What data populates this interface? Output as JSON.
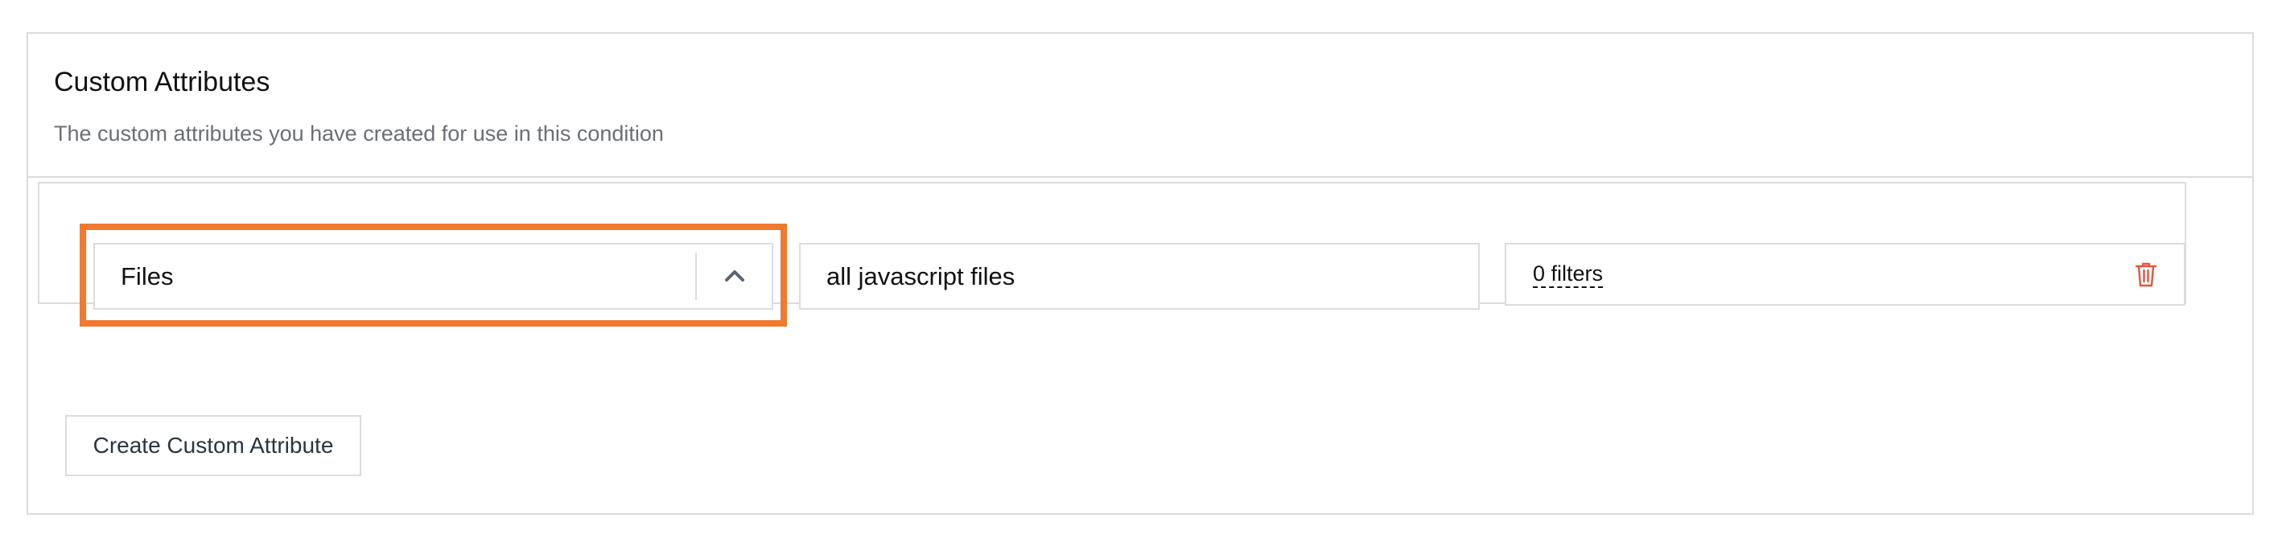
{
  "section": {
    "title": "Custom Attributes",
    "subtitle": "The custom attributes you have created for use in this condition"
  },
  "attributes": [
    {
      "type_select": {
        "value": "Files",
        "icon": "chevron-up-icon"
      },
      "name_input": {
        "value": "all javascript files"
      },
      "filters": {
        "label": "0 filters"
      },
      "delete_icon": "trash-icon"
    }
  ],
  "actions": {
    "create_label": "Create Custom Attribute"
  },
  "colors": {
    "highlight": "#f07a2f",
    "border": "#dcdcdc",
    "delete": "#e5533d",
    "muted_text": "#6b6f75"
  }
}
